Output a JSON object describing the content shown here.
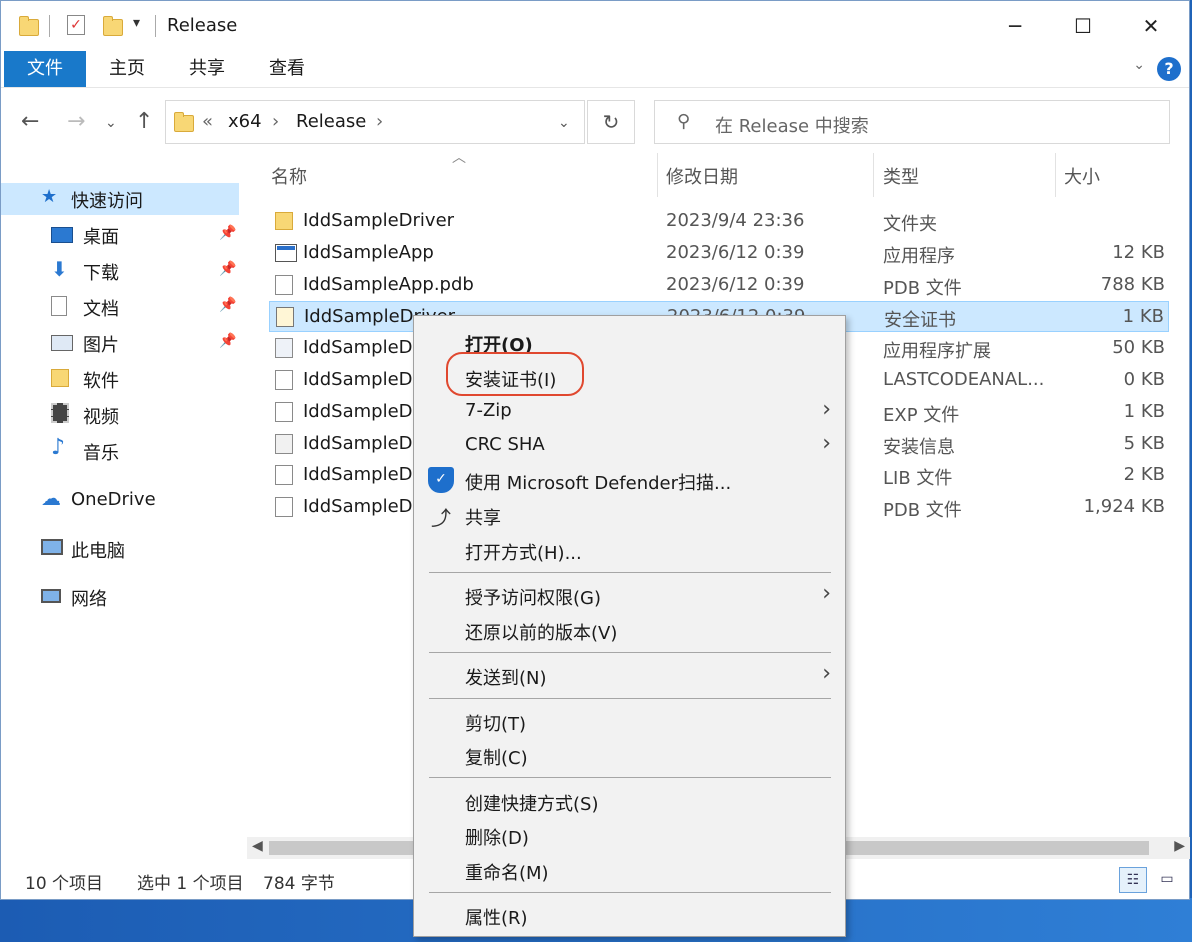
{
  "window": {
    "title": "Release",
    "controls": {
      "minimize": "─",
      "maximize": "☐",
      "close": "✕"
    }
  },
  "ribbon": {
    "tabs": [
      "文件",
      "主页",
      "共享",
      "查看"
    ],
    "help": "?"
  },
  "address": {
    "overflow": "«",
    "crumbs": [
      "x64",
      "Release"
    ],
    "separator": "›"
  },
  "search": {
    "placeholder": "在 Release 中搜索"
  },
  "nav": {
    "quick_access": "快速访问",
    "items": [
      {
        "label": "桌面",
        "icon": "desktop-icon",
        "pinned": true
      },
      {
        "label": "下载",
        "icon": "download-icon",
        "pinned": true
      },
      {
        "label": "文档",
        "icon": "documents-icon",
        "pinned": true
      },
      {
        "label": "图片",
        "icon": "pictures-icon",
        "pinned": true
      },
      {
        "label": "软件",
        "icon": "folder-icon",
        "pinned": false
      },
      {
        "label": "视频",
        "icon": "video-icon",
        "pinned": false
      },
      {
        "label": "音乐",
        "icon": "music-icon",
        "pinned": false
      }
    ],
    "onedrive": "OneDrive",
    "this_pc": "此电脑",
    "network": "网络"
  },
  "columns": {
    "name": "名称",
    "date": "修改日期",
    "type": "类型",
    "size": "大小"
  },
  "files": [
    {
      "name": "IddSampleDriver",
      "date": "2023/9/4 23:36",
      "type": "文件夹",
      "size": "",
      "icon": "folder-icon"
    },
    {
      "name": "IddSampleApp",
      "date": "2023/6/12 0:39",
      "type": "应用程序",
      "size": "12 KB",
      "icon": "application-icon"
    },
    {
      "name": "IddSampleApp.pdb",
      "date": "2023/6/12 0:39",
      "type": "PDB 文件",
      "size": "788 KB",
      "icon": "file-icon"
    },
    {
      "name": "IddSampleDriver",
      "date": "2023/6/12 0:39",
      "type": "安全证书",
      "size": "1 KB",
      "icon": "certificate-icon",
      "selected": true
    },
    {
      "name": "IddSampleD",
      "date": "",
      "type": "应用程序扩展",
      "size": "50 KB",
      "icon": "dll-icon"
    },
    {
      "name": "IddSampleD",
      "date": "",
      "type": "LASTCODEANAL...",
      "size": "0 KB",
      "icon": "file-icon"
    },
    {
      "name": "IddSampleD",
      "date": "",
      "type": "EXP 文件",
      "size": "1 KB",
      "icon": "file-icon"
    },
    {
      "name": "IddSampleD",
      "date": "",
      "type": "安装信息",
      "size": "5 KB",
      "icon": "setup-info-icon"
    },
    {
      "name": "IddSampleD",
      "date": "",
      "type": "LIB 文件",
      "size": "2 KB",
      "icon": "file-icon"
    },
    {
      "name": "IddSampleD",
      "date": "",
      "type": "PDB 文件",
      "size": "1,924 KB",
      "icon": "file-icon"
    }
  ],
  "status": {
    "count": "10 个项目",
    "selection": "选中 1 个项目",
    "size": "784 字节"
  },
  "context_menu": {
    "items": [
      {
        "label": "打开(O)",
        "bold": true
      },
      {
        "label": "安装证书(I)",
        "highlighted": true
      },
      {
        "label": "7-Zip",
        "submenu": true
      },
      {
        "label": "CRC SHA",
        "submenu": true
      },
      {
        "label": "使用 Microsoft Defender扫描...",
        "icon": "defender-shield-icon"
      },
      {
        "label": "共享",
        "icon": "share-icon"
      },
      {
        "label": "打开方式(H)..."
      },
      {
        "label": "授予访问权限(G)",
        "submenu": true
      },
      {
        "label": "还原以前的版本(V)"
      },
      {
        "label": "发送到(N)",
        "submenu": true
      },
      {
        "label": "剪切(T)"
      },
      {
        "label": "复制(C)"
      },
      {
        "label": "创建快捷方式(S)"
      },
      {
        "label": "删除(D)"
      },
      {
        "label": "重命名(M)"
      },
      {
        "label": "属性(R)"
      }
    ],
    "submenu_arrow": "›"
  },
  "colors": {
    "accent": "#1979ca",
    "selection": "#cce8ff",
    "highlight_circle": "#e0482f"
  }
}
